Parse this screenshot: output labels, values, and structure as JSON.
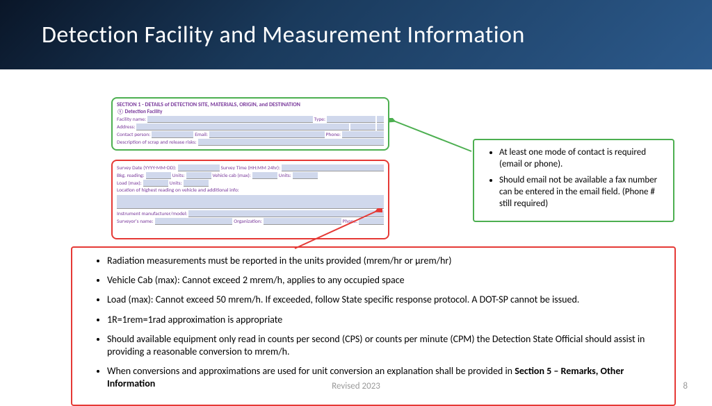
{
  "header": {
    "title": "Detection Facility and Measurement Information"
  },
  "form": {
    "section_title": "SECTION 1 - DETAILS of DETECTION SITE, MATERIALS, ORIGIN, and DESTINATION",
    "subsection": "① Detection Facility",
    "labels": {
      "facility": "Facility name:",
      "type": "Type:",
      "address": "Address:",
      "contact": "Contact person:",
      "email": "Email:",
      "phone": "Phone:",
      "desc": "Description of scrap and release risks:",
      "survey_date": "Survey Date (YYYY-MM-DD):",
      "survey_time": "Survey Time (HH:MM 24hr):",
      "bkg": "Bkg. reading:",
      "units": "Units:",
      "vehicle": "Vehicle cab (max):",
      "load": "Load (max):",
      "location": "Location of highest reading on vehicle and additional info:",
      "instrument": "Instrument manufacturer/model:",
      "surveyor": "Surveyor's name:",
      "org": "Organization:"
    }
  },
  "green_notes": [
    "At least one mode of contact is required (email or phone).",
    "Should email not be available a fax number can be entered in the email field. (Phone # still required)"
  ],
  "red_notes": [
    "Radiation measurements must be reported in the units provided (mrem/hr or µrem/hr)",
    "Vehicle Cab (max): Cannot exceed 2 mrem/h, applies to any occupied space",
    "Load (max): Cannot exceed 50 mrem/h. If exceeded, follow State specific response protocol. A DOT-SP cannot be issued.",
    "1R=1rem=1rad approximation is appropriate",
    "Should available equipment only read in counts per second (CPS) or counts per minute (CPM) the Detection State Official should assist in providing a reasonable conversion to mrem/h."
  ],
  "red_note_6_prefix": "When conversions and approximations are used for unit conversion an explanation shall be provided in ",
  "red_note_6_bold": "Section 5 – Remarks, Other Information",
  "footer": {
    "center": "Revised 2023",
    "page": "8"
  }
}
